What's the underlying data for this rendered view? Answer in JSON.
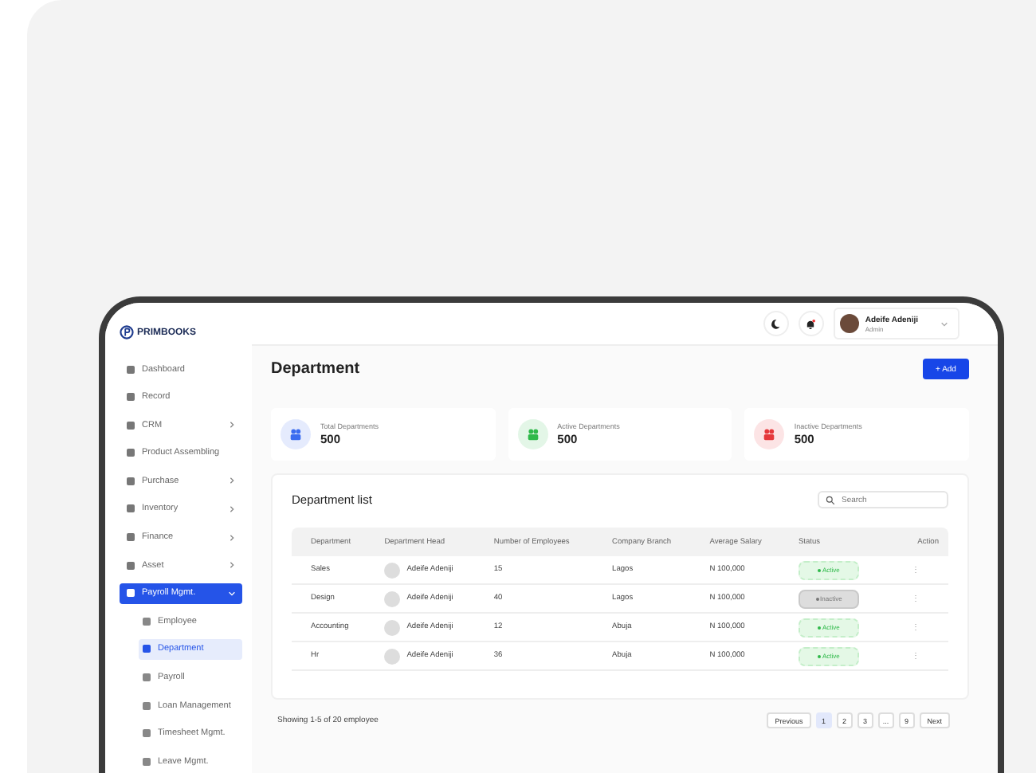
{
  "brand": {
    "name": "PRIMBOOKS"
  },
  "sidebar": {
    "items": [
      {
        "label": "Dashboard",
        "expandable": false,
        "expanded": false,
        "selected": false
      },
      {
        "label": "Record",
        "expandable": false,
        "expanded": false,
        "selected": false
      },
      {
        "label": "CRM",
        "expandable": true,
        "expanded": false,
        "selected": false
      },
      {
        "label": "Product Assembling",
        "expandable": false,
        "expanded": false,
        "selected": false
      },
      {
        "label": "Purchase",
        "expandable": true,
        "expanded": false,
        "selected": false
      },
      {
        "label": "Inventory",
        "expandable": true,
        "expanded": false,
        "selected": false
      },
      {
        "label": "Finance",
        "expandable": true,
        "expanded": false,
        "selected": false
      },
      {
        "label": "Asset",
        "expandable": true,
        "expanded": false,
        "selected": false
      },
      {
        "label": "Payroll Mgmt.",
        "expandable": true,
        "expanded": true,
        "selected": true,
        "children": [
          {
            "label": "Employee",
            "selected": false
          },
          {
            "label": "Department",
            "selected": true
          },
          {
            "label": "Payroll",
            "selected": false
          },
          {
            "label": "Loan Management",
            "selected": false
          },
          {
            "label": "Timesheet Mgmt.",
            "selected": false
          },
          {
            "label": "Leave Mgmt.",
            "selected": false
          }
        ]
      }
    ]
  },
  "user": {
    "name": "Adeife Adeniji",
    "role": "Admin"
  },
  "page": {
    "title": "Department",
    "add_button": "+ Add"
  },
  "stats": [
    {
      "label": "Total Departments",
      "value": "500",
      "color": "#3b6cf0"
    },
    {
      "label": "Active Departments",
      "value": "500",
      "color": "#2fb94a"
    },
    {
      "label": "Inactive Departments",
      "value": "500",
      "color": "#e5383b"
    }
  ],
  "table": {
    "title": "Department list",
    "search": {
      "placeholder": "Search"
    },
    "columns": [
      "Department",
      "Department Head",
      "Number of Employees",
      "Company Branch",
      "Average Salary",
      "Status",
      "Action"
    ],
    "rows": [
      {
        "department": "Sales",
        "head": "Adeife Adeniji",
        "employees": "15",
        "branch": "Lagos",
        "salary": "N 100,000",
        "status": "Active",
        "kind": "active",
        "action": "⋮"
      },
      {
        "department": "Design",
        "head": "Adeife Adeniji",
        "employees": "40",
        "branch": "Lagos",
        "salary": "N 100,000",
        "status": "Inactive",
        "kind": "inactive",
        "action": "⋮"
      },
      {
        "department": "Accounting",
        "head": "Adeife Adeniji",
        "employees": "12",
        "branch": "Abuja",
        "salary": "N 100,000",
        "status": "Active",
        "kind": "active",
        "action": "⋮"
      },
      {
        "department": "Hr",
        "head": "Adeife Adeniji",
        "employees": "36",
        "branch": "Abuja",
        "salary": "N 100,000",
        "status": "Active",
        "kind": "active",
        "action": "⋮"
      }
    ]
  },
  "footer": {
    "summary": "Showing 1-5 of 20 employee",
    "previous": "Previous",
    "next": "Next",
    "pages": [
      {
        "label": "1",
        "selected": true
      },
      {
        "label": "2",
        "selected": false
      },
      {
        "label": "3",
        "selected": false
      },
      {
        "label": "...",
        "selected": false
      },
      {
        "label": "9",
        "selected": false
      }
    ]
  }
}
